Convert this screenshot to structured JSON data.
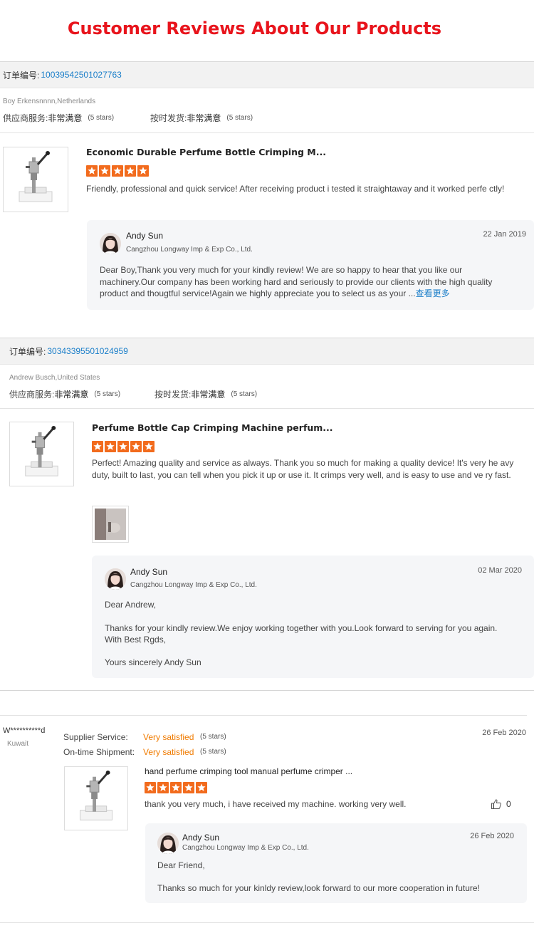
{
  "page_title": "Customer Reviews About Our Products",
  "reviews": [
    {
      "order_label": "订单编号:",
      "order_number": "10039542501027763",
      "buyer": "Boy Erkensnnnn,Netherlands",
      "supplier_service_label": "供应商服务:",
      "supplier_service_value": "非常满意",
      "supplier_service_stars": "(5 stars)",
      "shipment_label": "按时发货:",
      "shipment_value": "非常满意",
      "shipment_stars": "(5 stars)",
      "product_title": "Economic Durable Perfume Bottle Crimping M...",
      "rating": 5,
      "text": "Friendly, professional and quick service! After receiving product i tested it straightaway and it worked perfe ctly!",
      "reply": {
        "name": "Andy Sun",
        "company": "Cangzhou Longway Imp & Exp Co., Ltd.",
        "date": "22 Jan 2019",
        "text": "Dear Boy,Thank you very much for your kindly review! We are so happy to hear that you like our machinery.Our company has been working hard and seriously to provide our clients with the high quality product and thougtful service!Again we highly appreciate you to select us as your ...",
        "more_link": "查看更多"
      }
    },
    {
      "order_label": "订单编号:",
      "order_number": "30343395501024959",
      "buyer": "Andrew Busch,United States",
      "supplier_service_label": "供应商服务:",
      "supplier_service_value": "非常满意",
      "supplier_service_stars": "(5 stars)",
      "shipment_label": "按时发货:",
      "shipment_value": "非常满意",
      "shipment_stars": "(5 stars)",
      "product_title": "Perfume Bottle Cap Crimping Machine perfum...",
      "rating": 5,
      "text": "Perfect! Amazing quality and service as always. Thank you so much for making a quality device! It's very he avy duty, built to last, you can tell when you pick it up or use it. It crimps very well, and is easy to use and ve ry fast.",
      "reply": {
        "name": "Andy Sun",
        "company": "Cangzhou Longway Imp & Exp Co., Ltd.",
        "date": "02 Mar 2020",
        "line1": "Dear Andrew,",
        "line2": "Thanks for your kindly review.We enjoy working together with you.Look forward to serving for you again.",
        "line3": "With Best Rgds,",
        "line4": "Yours sincerely Andy Sun"
      }
    },
    {
      "buyer_name": "W**********d",
      "buyer_country": "Kuwait",
      "supplier_service_label": "Supplier Service:",
      "supplier_service_value": "Very satisfied",
      "supplier_service_stars": "(5 stars)",
      "shipment_label": "On-time Shipment:",
      "shipment_value": "Very satisfied",
      "shipment_stars": "(5 stars)",
      "date": "26 Feb 2020",
      "product_title": "hand perfume crimping tool manual perfume crimper ...",
      "rating": 5,
      "text": "thank you very much, i have received my machine. working very well.",
      "likes": "0",
      "reply": {
        "name": "Andy Sun",
        "company": "Cangzhou Longway Imp & Exp Co., Ltd.",
        "date": "26 Feb 2020",
        "line1": "Dear Friend,",
        "line2": "Thanks so much for your kinldy review,look forward to our more cooperation in future!"
      }
    }
  ],
  "colors": {
    "title_red": "#e8141c",
    "link_blue": "#1a7ec9",
    "star_orange": "#f26b1d",
    "satisfied_orange": "#f07b00"
  }
}
